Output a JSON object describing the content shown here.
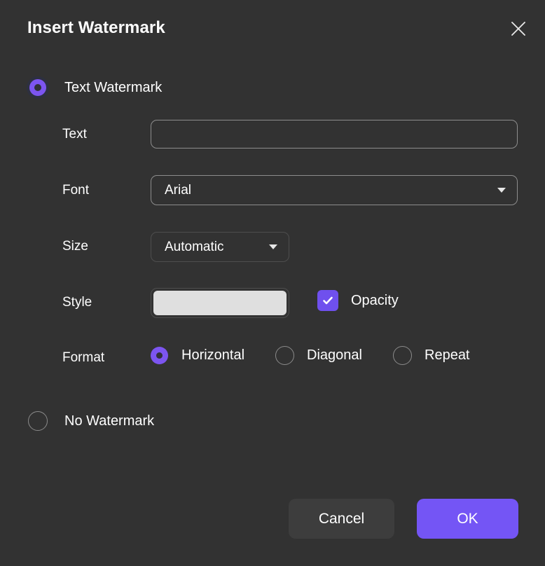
{
  "dialog": {
    "title": "Insert Watermark",
    "close_icon": "close-icon"
  },
  "options": {
    "text_watermark": {
      "label": "Text Watermark",
      "selected": true
    },
    "no_watermark": {
      "label": "No Watermark",
      "selected": false
    }
  },
  "fields": {
    "text": {
      "label": "Text",
      "value": "",
      "placeholder": ""
    },
    "font": {
      "label": "Font",
      "value": "Arial",
      "caret_icon": "chevron-down-icon"
    },
    "size": {
      "label": "Size",
      "value": "Automatic",
      "caret_icon": "chevron-down-icon"
    },
    "style": {
      "label": "Style",
      "swatch_color": "#dfdfdf"
    },
    "opacity": {
      "label": "Opacity",
      "checked": true,
      "check_icon": "checkmark-icon"
    },
    "format": {
      "label": "Format",
      "options": [
        {
          "label": "Horizontal",
          "selected": true
        },
        {
          "label": "Diagonal",
          "selected": false
        },
        {
          "label": "Repeat",
          "selected": false
        }
      ]
    }
  },
  "footer": {
    "cancel_label": "Cancel",
    "ok_label": "OK"
  },
  "colors": {
    "background": "#323232",
    "accent": "#7455f5",
    "accent_radio": "#7c55f0",
    "accent_checkbox": "#6f50ee",
    "cancel_button": "#3d3d3d",
    "swatch": "#dfdfdf",
    "border_light": "#8d8d8d",
    "border_dark": "#4e4e4e",
    "text": "#ffffff"
  }
}
